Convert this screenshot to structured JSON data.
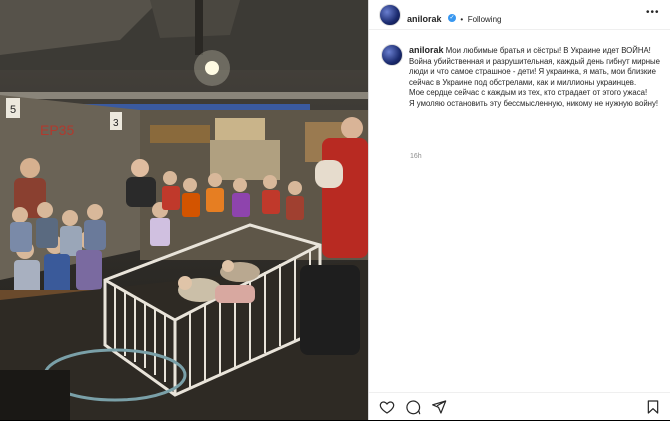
{
  "post": {
    "username": "anilorak",
    "verified_glyph": "✓",
    "follow_separator": "•",
    "follow_label": "Following",
    "more_glyph": "•••",
    "caption": "Мои любимые братья и сёстры! В Украине идет ВОЙНА! Война убийственная и разрушительная, каждый день гибнут мирные люди и что самое страшное - дети! Я украинка, я мать, мои близкие сейчас в Украине под обстрелами, как и миллионы украинцев.\nМое сердце сейчас с каждым из тех, кто страдает от этого ужаса!\nЯ умоляю остановить эту бессмысленную, никому не нужную войну!",
    "time_ago": "16h"
  },
  "photo": {
    "wall_numbers": [
      "5",
      "3"
    ],
    "wall_graffiti": "ЕР35"
  },
  "icons": {
    "like": "heart-icon",
    "comment": "comment-icon",
    "share": "send-icon",
    "save": "bookmark-icon"
  },
  "colors": {
    "verified": "#3897f0",
    "text": "#262626",
    "muted": "#8e8e8e"
  }
}
